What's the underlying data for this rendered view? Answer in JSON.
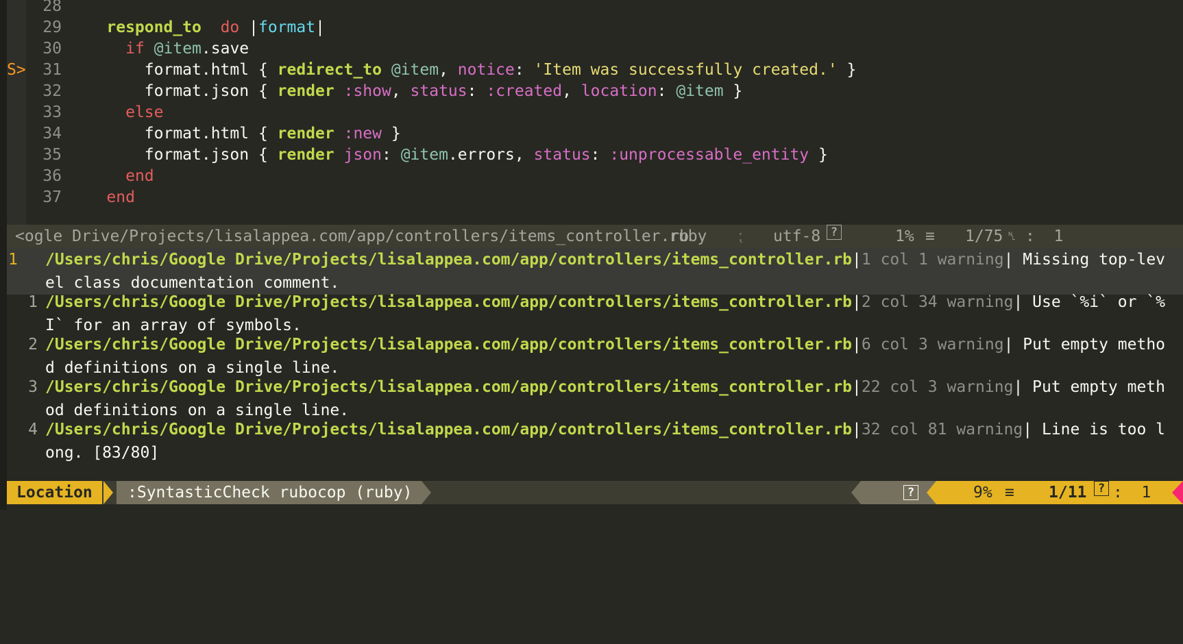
{
  "editor": {
    "lines": [
      {
        "num": "28",
        "sign": "",
        "segs": []
      },
      {
        "num": "29",
        "sign": "",
        "segs": [
          [
            "fn",
            "    respond_to"
          ],
          [
            "",
            "  "
          ],
          [
            "red",
            "do"
          ],
          [
            "",
            " |"
          ],
          [
            "pipe",
            "format"
          ],
          [
            "",
            "|"
          ]
        ]
      },
      {
        "num": "30",
        "sign": "",
        "segs": [
          [
            "",
            "      "
          ],
          [
            "red",
            "if"
          ],
          [
            "",
            " "
          ],
          [
            "iv",
            "@item"
          ],
          [
            "",
            ".save"
          ]
        ]
      },
      {
        "num": "31",
        "sign": "S>",
        "segs": [
          [
            "",
            "        format.html { "
          ],
          [
            "fn",
            "redirect_to"
          ],
          [
            "",
            " "
          ],
          [
            "iv",
            "@item"
          ],
          [
            "",
            ", "
          ],
          [
            "sym",
            "notice"
          ],
          [
            "",
            ": "
          ],
          [
            "str",
            "'Item was successfully created.'"
          ],
          [
            "",
            " }"
          ]
        ]
      },
      {
        "num": "32",
        "sign": "",
        "segs": [
          [
            "",
            "        format.json { "
          ],
          [
            "fn",
            "render"
          ],
          [
            "",
            " "
          ],
          [
            "sym",
            ":show"
          ],
          [
            "",
            ", "
          ],
          [
            "sym",
            "status"
          ],
          [
            "",
            ": "
          ],
          [
            "sym",
            ":created"
          ],
          [
            "",
            ", "
          ],
          [
            "sym",
            "location"
          ],
          [
            "",
            ": "
          ],
          [
            "iv",
            "@item"
          ],
          [
            "",
            " }"
          ]
        ]
      },
      {
        "num": "33",
        "sign": "",
        "segs": [
          [
            "",
            "      "
          ],
          [
            "red",
            "else"
          ]
        ]
      },
      {
        "num": "34",
        "sign": "",
        "segs": [
          [
            "",
            "        format.html { "
          ],
          [
            "fn",
            "render"
          ],
          [
            "",
            " "
          ],
          [
            "sym",
            ":new"
          ],
          [
            "",
            " }"
          ]
        ]
      },
      {
        "num": "35",
        "sign": "",
        "segs": [
          [
            "",
            "        format.json { "
          ],
          [
            "fn",
            "render"
          ],
          [
            "",
            " "
          ],
          [
            "sym",
            "json"
          ],
          [
            "",
            ": "
          ],
          [
            "iv",
            "@item"
          ],
          [
            "",
            ".errors, "
          ],
          [
            "sym",
            "status"
          ],
          [
            "",
            ": "
          ],
          [
            "sym",
            ":unprocessable_entity"
          ],
          [
            "",
            " }"
          ]
        ]
      },
      {
        "num": "36",
        "sign": "",
        "segs": [
          [
            "",
            "      "
          ],
          [
            "red",
            "end"
          ]
        ]
      },
      {
        "num": "37",
        "sign": "",
        "segs": [
          [
            "",
            "    "
          ],
          [
            "red",
            "end"
          ]
        ]
      }
    ]
  },
  "statusline": {
    "path": "<ogle Drive/Projects/lisalappea.com/app/controllers/items_controller.rb",
    "filetype": "ruby",
    "sep": "⁏",
    "encoding": "utf-8",
    "percent": "1%",
    "position": "1/75",
    "ln_icon": "␤",
    "col": ":  1",
    "unknown_icon": "?"
  },
  "quickfix": {
    "rows": [
      {
        "num": "1",
        "path": "/Users/chris/Google Drive/Projects/lisalappea.com/app/controllers/items_controller.rb",
        "loc": "1 col 1 warning",
        "msg": " Missing top-lev",
        "cont": "el class documentation comment."
      },
      {
        "num": "1",
        "path": "/Users/chris/Google Drive/Projects/lisalappea.com/app/controllers/items_controller.rb",
        "loc": "2 col 34 warning",
        "msg": " Use `%i` or `%",
        "cont": "I` for an array of symbols."
      },
      {
        "num": "2",
        "path": "/Users/chris/Google Drive/Projects/lisalappea.com/app/controllers/items_controller.rb",
        "loc": "6 col 3 warning",
        "msg": " Put empty metho",
        "cont": "d definitions on a single line."
      },
      {
        "num": "3",
        "path": "/Users/chris/Google Drive/Projects/lisalappea.com/app/controllers/items_controller.rb",
        "loc": "22 col 3 warning",
        "msg": " Put empty meth",
        "cont": "od definitions on a single line."
      },
      {
        "num": "4",
        "path": "/Users/chris/Google Drive/Projects/lisalappea.com/app/controllers/items_controller.rb",
        "loc": "32 col 81 warning",
        "msg": " Line is too l",
        "cont": "ong. [83/80]"
      }
    ]
  },
  "bottombar": {
    "mode": "Location",
    "command": ":SyntasticCheck rubocop (ruby)",
    "percent": "9%",
    "position": "1/11",
    "col": ":  1",
    "unknown_icon": "?",
    "menu_icon": "≡"
  },
  "colors": {
    "background": "#272822",
    "accent": "#e6b422",
    "path": "#c2d94c"
  }
}
